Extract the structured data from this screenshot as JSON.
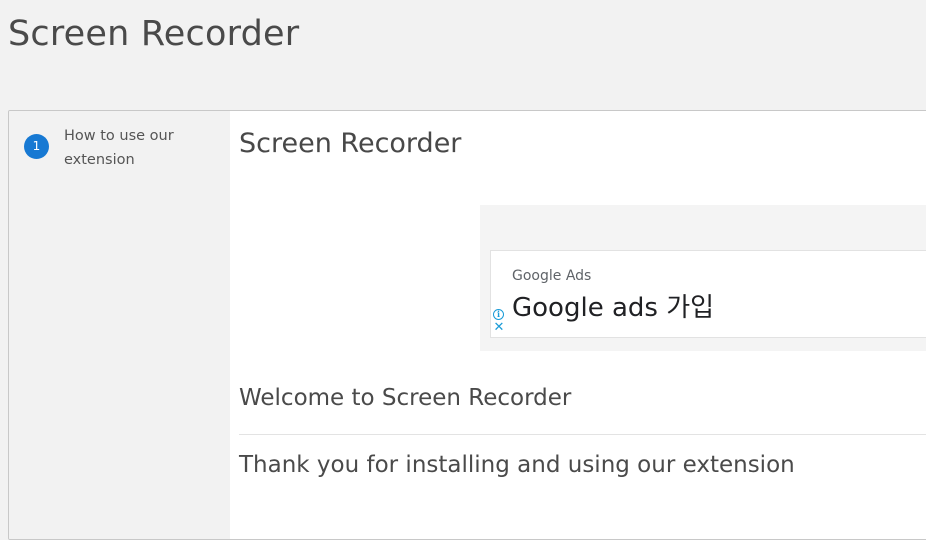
{
  "header": {
    "title": "Screen Recorder"
  },
  "steps": [
    {
      "number": "1",
      "label": "How to use our extension"
    }
  ],
  "content": {
    "title": "Screen Recorder",
    "ad": {
      "label": "Google Ads",
      "headline": "Google ads 가입",
      "info_icon": "info-icon",
      "close_icon": "close-icon"
    },
    "welcome": "Welcome to Screen Recorder",
    "thank_you": "Thank you for installing and using our extension"
  },
  "colors": {
    "accent": "#1779d3",
    "ad_icon": "#1a9bd7"
  }
}
